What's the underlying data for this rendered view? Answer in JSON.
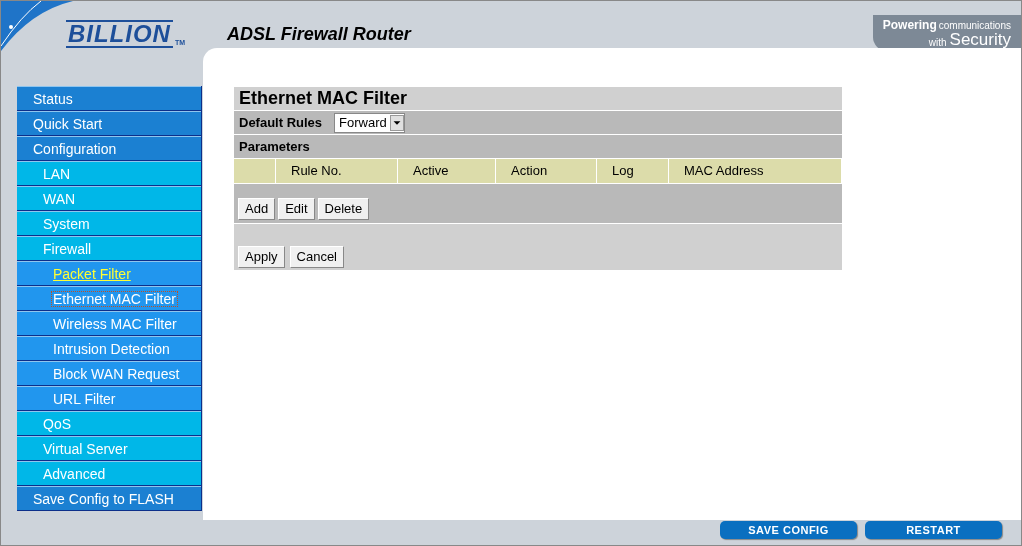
{
  "header": {
    "brand": "BILLION",
    "trademark": "TM",
    "title": "ADSL Firewall Router",
    "slogan_small": "Powering",
    "slogan_small_2": "communications",
    "slogan_with": "with",
    "slogan_big": "Security"
  },
  "sidebar": {
    "items": [
      {
        "label": "Status",
        "selected": false,
        "hovered": false
      },
      {
        "label": "Quick Start",
        "selected": false,
        "hovered": false
      },
      {
        "label": "Configuration",
        "selected": false,
        "hovered": false,
        "children": [
          {
            "label": "LAN",
            "selected": false,
            "hovered": false
          },
          {
            "label": "WAN",
            "selected": false,
            "hovered": false
          },
          {
            "label": "System",
            "selected": false,
            "hovered": false
          },
          {
            "label": "Firewall",
            "selected": false,
            "hovered": false,
            "children": [
              {
                "label": "Packet Filter",
                "selected": false,
                "hovered": true
              },
              {
                "label": "Ethernet MAC Filter",
                "selected": true,
                "hovered": false
              },
              {
                "label": "Wireless MAC Filter",
                "selected": false,
                "hovered": false
              },
              {
                "label": "Intrusion Detection",
                "selected": false,
                "hovered": false
              },
              {
                "label": "Block WAN Request",
                "selected": false,
                "hovered": false
              },
              {
                "label": "URL Filter",
                "selected": false,
                "hovered": false
              }
            ]
          },
          {
            "label": "QoS",
            "selected": false,
            "hovered": false
          },
          {
            "label": "Virtual Server",
            "selected": false,
            "hovered": false
          },
          {
            "label": "Advanced",
            "selected": false,
            "hovered": false
          }
        ]
      },
      {
        "label": "Save Config to FLASH",
        "selected": false,
        "hovered": false
      }
    ]
  },
  "form": {
    "title": "Ethernet MAC Filter",
    "default_rules_label": "Default Rules",
    "default_rules_value": "Forward",
    "parameters_label": "Parameters",
    "columns": [
      "",
      "Rule No.",
      "Active",
      "Action",
      "Log",
      "MAC Address"
    ],
    "row_buttons": [
      "Add",
      "Edit",
      "Delete"
    ],
    "buttons": [
      "Apply",
      "Cancel"
    ]
  },
  "footer_buttons": [
    "SAVE CONFIG",
    "RESTART"
  ]
}
